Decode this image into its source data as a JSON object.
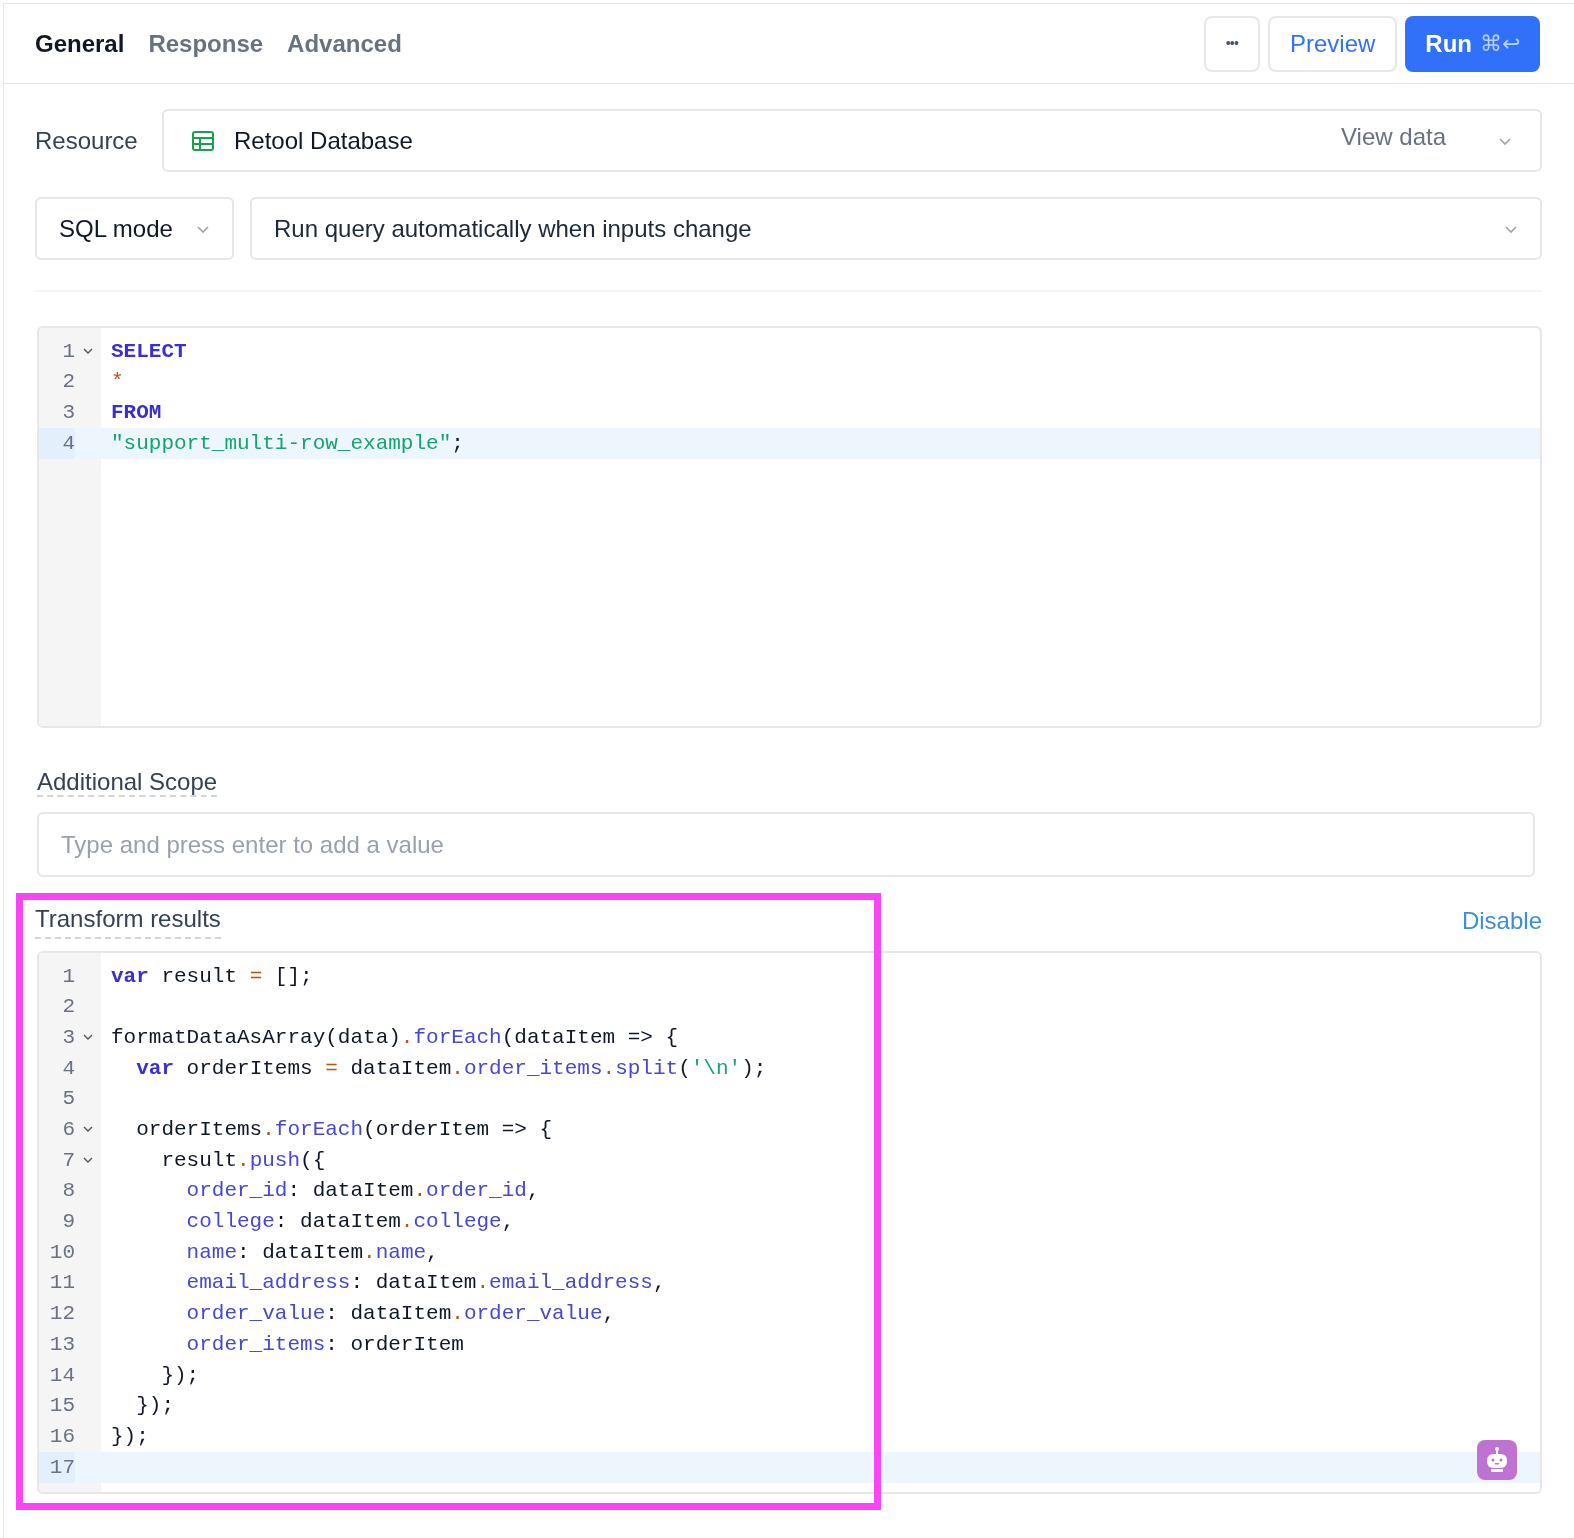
{
  "tabs": [
    {
      "label": "General",
      "selected": true
    },
    {
      "label": "Response",
      "selected": false
    },
    {
      "label": "Advanced",
      "selected": false
    }
  ],
  "toolbar": {
    "more": "•••",
    "preview": "Preview",
    "run": "Run",
    "shortcut": "⌘↩"
  },
  "resource": {
    "label": "Resource",
    "value": "Retool Database",
    "link": "View data"
  },
  "mode": {
    "value": "SQL mode"
  },
  "trigger": {
    "value": "Run query automatically when inputs change"
  },
  "query_editor": {
    "lines": [
      {
        "number": "1",
        "foldable": true,
        "active": false,
        "tokens": [
          {
            "t": "SELECT",
            "kind": "keyword"
          }
        ]
      },
      {
        "number": "2",
        "foldable": false,
        "active": false,
        "tokens": [
          {
            "t": "*",
            "kind": "operator"
          }
        ]
      },
      {
        "number": "3",
        "foldable": false,
        "active": false,
        "tokens": [
          {
            "t": "FROM",
            "kind": "keyword"
          }
        ]
      },
      {
        "number": "4",
        "foldable": false,
        "active": true,
        "tokens": [
          {
            "t": "\"support_multi-row_example\"",
            "kind": "string"
          },
          {
            "t": ";",
            "kind": "plain"
          }
        ]
      }
    ]
  },
  "additional_scope": {
    "label": "Additional Scope",
    "placeholder": "Type and press enter to add a value"
  },
  "transform": {
    "label": "Transform results",
    "action": "Disable",
    "highlighted": true,
    "lines": [
      {
        "number": "1",
        "foldable": false,
        "active": false,
        "tokens": [
          {
            "t": "var",
            "kind": "keyword"
          },
          {
            "t": " result ",
            "kind": "plain"
          },
          {
            "t": "=",
            "kind": "operator"
          },
          {
            "t": " [];",
            "kind": "plain"
          }
        ]
      },
      {
        "number": "2",
        "foldable": false,
        "active": false
      },
      {
        "number": "3",
        "foldable": true,
        "active": false,
        "tokens": [
          {
            "t": "formatDataAsArray(data)",
            "kind": "plain"
          },
          {
            "t": ".",
            "kind": "operator"
          },
          {
            "t": "forEach",
            "kind": "property"
          },
          {
            "t": "(dataItem => {",
            "kind": "plain"
          }
        ]
      },
      {
        "number": "4",
        "foldable": false,
        "active": false,
        "tokens": [
          {
            "t": "  var",
            "kind": "keyword"
          },
          {
            "t": " orderItems ",
            "kind": "plain"
          },
          {
            "t": "=",
            "kind": "operator"
          },
          {
            "t": " dataItem",
            "kind": "plain"
          },
          {
            "t": ".",
            "kind": "operator"
          },
          {
            "t": "order_items",
            "kind": "property"
          },
          {
            "t": ".",
            "kind": "operator"
          },
          {
            "t": "split",
            "kind": "property"
          },
          {
            "t": "(",
            "kind": "plain"
          },
          {
            "t": "'\\n'",
            "kind": "string"
          },
          {
            "t": ");",
            "kind": "plain"
          }
        ]
      },
      {
        "number": "5",
        "foldable": false,
        "active": false
      },
      {
        "number": "6",
        "foldable": true,
        "active": false,
        "tokens": [
          {
            "t": "  orderItems",
            "kind": "plain"
          },
          {
            "t": ".",
            "kind": "operator"
          },
          {
            "t": "forEach",
            "kind": "property"
          },
          {
            "t": "(orderItem => {",
            "kind": "plain"
          }
        ]
      },
      {
        "number": "7",
        "foldable": true,
        "active": false,
        "tokens": [
          {
            "t": "    result",
            "kind": "plain"
          },
          {
            "t": ".",
            "kind": "operator"
          },
          {
            "t": "push",
            "kind": "property"
          },
          {
            "t": "({",
            "kind": "plain"
          }
        ]
      },
      {
        "number": "8",
        "foldable": false,
        "active": false,
        "tokens": [
          {
            "t": "      order_id",
            "kind": "property"
          },
          {
            "t": ": dataItem",
            "kind": "plain"
          },
          {
            "t": ".",
            "kind": "operator"
          },
          {
            "t": "order_id",
            "kind": "property"
          },
          {
            "t": ",",
            "kind": "plain"
          }
        ]
      },
      {
        "number": "9",
        "foldable": false,
        "active": false,
        "tokens": [
          {
            "t": "      college",
            "kind": "property"
          },
          {
            "t": ": dataItem",
            "kind": "plain"
          },
          {
            "t": ".",
            "kind": "operator"
          },
          {
            "t": "college",
            "kind": "property"
          },
          {
            "t": ",",
            "kind": "plain"
          }
        ]
      },
      {
        "number": "10",
        "foldable": false,
        "active": false,
        "tokens": [
          {
            "t": "      name",
            "kind": "property"
          },
          {
            "t": ": dataItem",
            "kind": "plain"
          },
          {
            "t": ".",
            "kind": "operator"
          },
          {
            "t": "name",
            "kind": "property"
          },
          {
            "t": ",",
            "kind": "plain"
          }
        ]
      },
      {
        "number": "11",
        "foldable": false,
        "active": false,
        "tokens": [
          {
            "t": "      email_address",
            "kind": "property"
          },
          {
            "t": ": dataItem",
            "kind": "plain"
          },
          {
            "t": ".",
            "kind": "operator"
          },
          {
            "t": "email_address",
            "kind": "property"
          },
          {
            "t": ",",
            "kind": "plain"
          }
        ]
      },
      {
        "number": "12",
        "foldable": false,
        "active": false,
        "tokens": [
          {
            "t": "      order_value",
            "kind": "property"
          },
          {
            "t": ": dataItem",
            "kind": "plain"
          },
          {
            "t": ".",
            "kind": "operator"
          },
          {
            "t": "order_value",
            "kind": "property"
          },
          {
            "t": ",",
            "kind": "plain"
          }
        ]
      },
      {
        "number": "13",
        "foldable": false,
        "active": false,
        "tokens": [
          {
            "t": "      order_items",
            "kind": "property"
          },
          {
            "t": ": orderItem",
            "kind": "plain"
          }
        ]
      },
      {
        "number": "14",
        "foldable": false,
        "active": false,
        "tokens": [
          {
            "t": "    });",
            "kind": "plain"
          }
        ]
      },
      {
        "number": "15",
        "foldable": false,
        "active": false,
        "tokens": [
          {
            "t": "  });",
            "kind": "plain"
          }
        ]
      },
      {
        "number": "16",
        "foldable": false,
        "active": false,
        "tokens": [
          {
            "t": "});",
            "kind": "plain"
          }
        ]
      },
      {
        "number": "17",
        "foldable": false,
        "active": true
      }
    ]
  }
}
